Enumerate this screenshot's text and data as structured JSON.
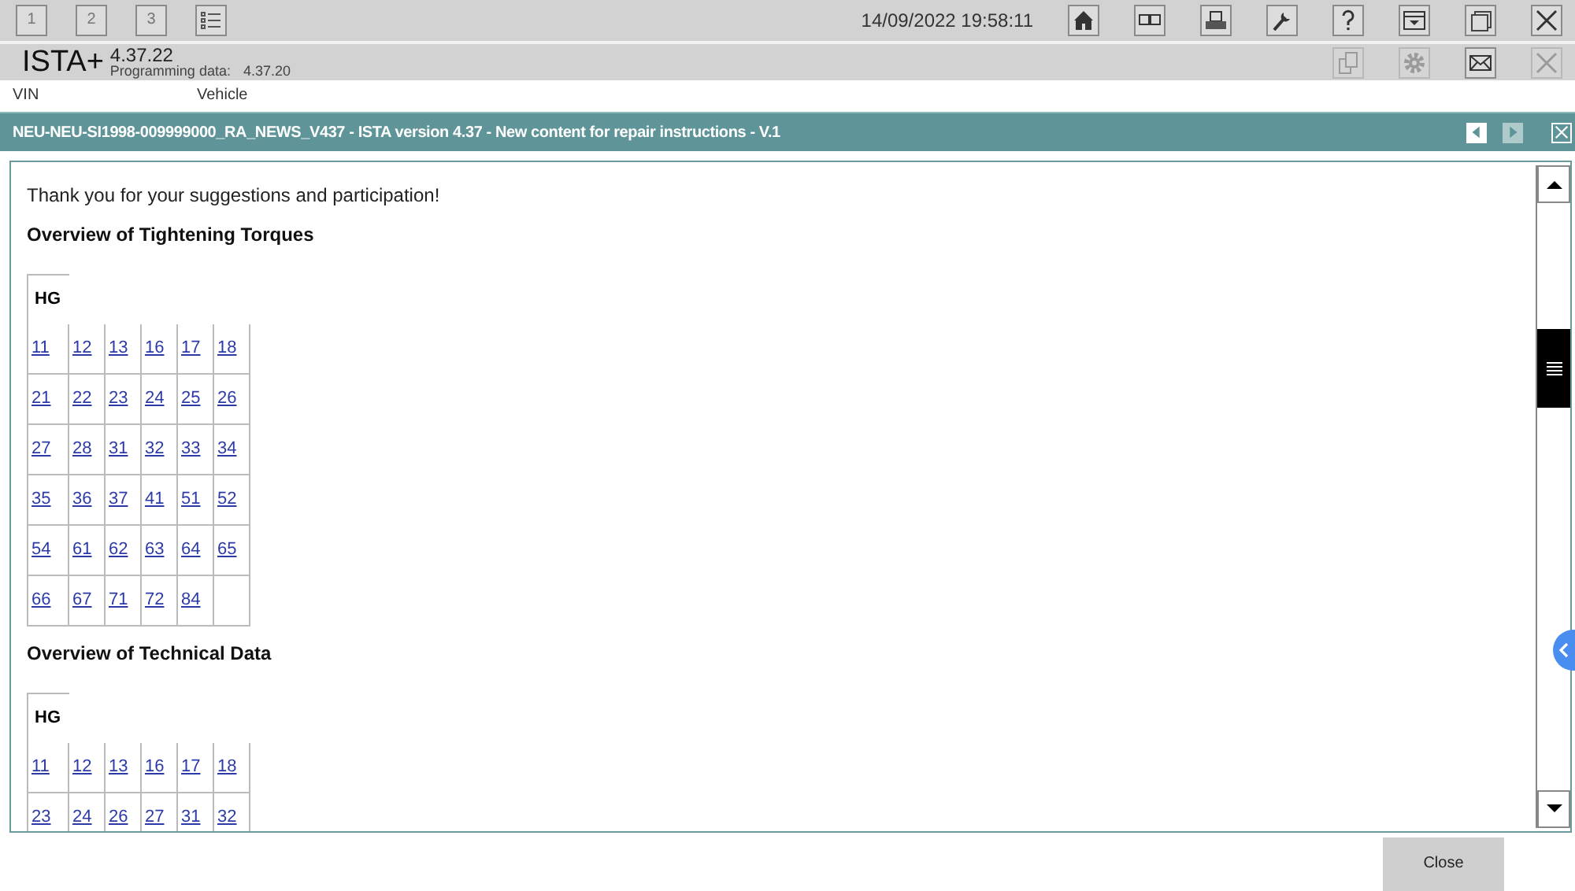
{
  "top_bar": {
    "screens": [
      "1",
      "2",
      "3"
    ],
    "datetime": "14/09/2022 19:58:11",
    "tools": [
      {
        "kind": "home"
      },
      {
        "kind": "split"
      },
      {
        "kind": "printer"
      },
      {
        "kind": "wrench"
      },
      {
        "kind": "help"
      },
      {
        "kind": "download"
      },
      {
        "kind": "window"
      },
      {
        "kind": "close"
      }
    ]
  },
  "app_bar": {
    "title": "ISTA+",
    "version": "4.37.22",
    "programming_label": "Programming data:",
    "programming_version": "4.37.20",
    "tools": [
      {
        "kind": "copy",
        "disabled": true
      },
      {
        "kind": "gear",
        "disabled": true
      },
      {
        "kind": "mail",
        "disabled": false
      },
      {
        "kind": "close",
        "disabled": true
      }
    ]
  },
  "vehicle_bar": {
    "vin_label": "VIN",
    "vehicle_label": "Vehicle"
  },
  "document": {
    "title": "NEU-NEU-SI1998-009999000_RA_NEWS_V437 - ISTA version 4.37 - New content for repair instructions - V.1",
    "nav": [
      {
        "kind": "prev",
        "disabled": false
      },
      {
        "kind": "next",
        "disabled": true
      },
      {
        "kind": "close",
        "disabled": false
      }
    ],
    "paragraph": "Thank you for your suggestions and participation!",
    "sections": [
      {
        "heading": "Overview of Tightening Torques",
        "table": {
          "header": "HG",
          "rows": [
            [
              "11",
              "12",
              "13",
              "16",
              "17",
              "18"
            ],
            [
              "21",
              "22",
              "23",
              "24",
              "25",
              "26"
            ],
            [
              "27",
              "28",
              "31",
              "32",
              "33",
              "34"
            ],
            [
              "35",
              "36",
              "37",
              "41",
              "51",
              "52"
            ],
            [
              "54",
              "61",
              "62",
              "63",
              "64",
              "65"
            ],
            [
              "66",
              "67",
              "71",
              "72",
              "84"
            ]
          ]
        }
      },
      {
        "heading": "Overview of Technical Data",
        "table": {
          "header": "HG",
          "rows": [
            [
              "11",
              "12",
              "13",
              "16",
              "17",
              "18"
            ],
            [
              "23",
              "24",
              "26",
              "27",
              "31",
              "32"
            ]
          ]
        }
      }
    ]
  },
  "footer": {
    "close_button": "Close"
  }
}
